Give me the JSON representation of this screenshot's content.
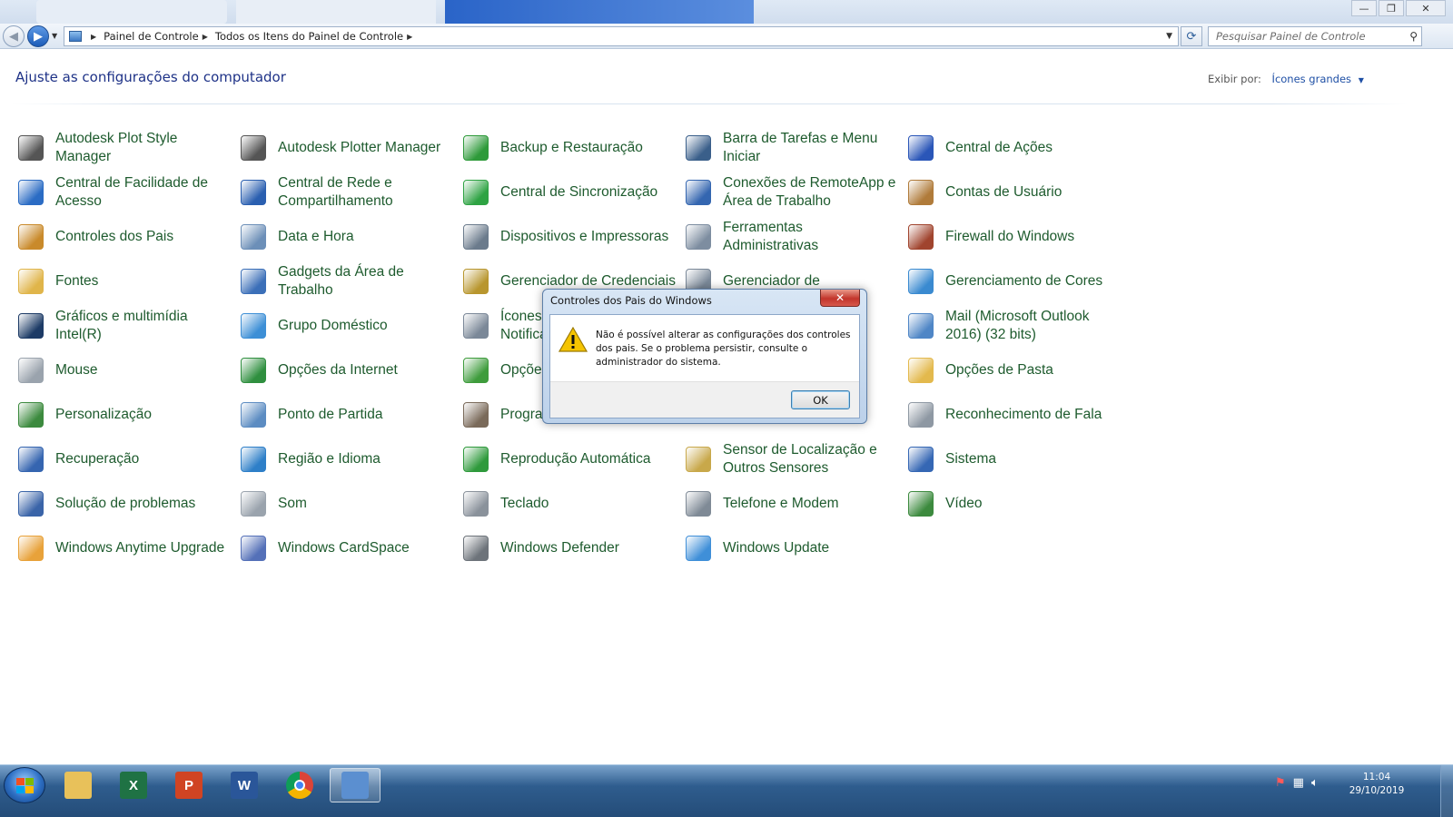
{
  "window": {
    "controls": {
      "minimize": "—",
      "restore": "❐",
      "close": "✕"
    }
  },
  "address": {
    "crumbs": [
      "Painel de Controle",
      "Todos os Itens do Painel de Controle"
    ],
    "search_placeholder": "Pesquisar Painel de Controle"
  },
  "header": {
    "title": "Ajuste as configurações do computador",
    "view_by_label": "Exibir por:",
    "view_by_value": "Ícones grandes"
  },
  "items": [
    {
      "label": "Autodesk Plot Style Manager",
      "icon": "printer-icon",
      "color": "#555555"
    },
    {
      "label": "Autodesk Plotter Manager",
      "icon": "plotter-icon",
      "color": "#555555"
    },
    {
      "label": "Backup e Restauração",
      "icon": "backup-icon",
      "color": "#2e9a3a"
    },
    {
      "label": "Barra de Tarefas e Menu Iniciar",
      "icon": "taskbar-icon",
      "color": "#3a5f8a"
    },
    {
      "label": "Central de Ações",
      "icon": "action-flag-icon",
      "color": "#2a56b8"
    },
    {
      "label": "Central de Facilidade de Acesso",
      "icon": "accessibility-icon",
      "color": "#2b6cc4"
    },
    {
      "label": "Central de Rede e Compartilhamento",
      "icon": "network-icon",
      "color": "#2a5fb0"
    },
    {
      "label": "Central de Sincronização",
      "icon": "sync-icon",
      "color": "#2ea343"
    },
    {
      "label": "Conexões de RemoteApp e Área de Trabalho",
      "icon": "remoteapp-icon",
      "color": "#3466b0"
    },
    {
      "label": "Contas de Usuário",
      "icon": "users-icon",
      "color": "#b07b3a"
    },
    {
      "label": "Controles dos Pais",
      "icon": "parental-icon",
      "color": "#c98a2b"
    },
    {
      "label": "Data e Hora",
      "icon": "calendar-icon",
      "color": "#6c8fb8"
    },
    {
      "label": "Dispositivos e Impressoras",
      "icon": "devices-icon",
      "color": "#6b7b8c"
    },
    {
      "label": "Ferramentas Administrativas",
      "icon": "admin-tools-icon",
      "color": "#7d8da0"
    },
    {
      "label": "Firewall do Windows",
      "icon": "firewall-icon",
      "color": "#a0442e"
    },
    {
      "label": "Fontes",
      "icon": "fonts-icon",
      "color": "#e0b54a"
    },
    {
      "label": "Gadgets da Área de Trabalho",
      "icon": "gadgets-icon",
      "color": "#3b6fb8"
    },
    {
      "label": "Gerenciador de Credenciais",
      "icon": "credentials-icon",
      "color": "#b8962e"
    },
    {
      "label": "Gerenciador de",
      "icon": "device-manager-icon",
      "color": "#7a8898"
    },
    {
      "label": "Gerenciamento de Cores",
      "icon": "color-mgmt-icon",
      "color": "#3a8ad0"
    },
    {
      "label": "Gráficos e multimídia Intel(R)",
      "icon": "intel-graphics-icon",
      "color": "#1d3b66"
    },
    {
      "label": "Grupo Doméstico",
      "icon": "homegroup-icon",
      "color": "#3d8fd6"
    },
    {
      "label": "Ícones da Área de Notificação",
      "icon": "notification-icon",
      "color": "#7b8898"
    },
    {
      "label": "",
      "icon": "hidden-icon",
      "color": "#ffffff"
    },
    {
      "label": "Mail (Microsoft Outlook 2016) (32 bits)",
      "icon": "mail-icon",
      "color": "#4f86c6"
    },
    {
      "label": "Mouse",
      "icon": "mouse-icon",
      "color": "#9aa3ad"
    },
    {
      "label": "Opções da Internet",
      "icon": "internet-options-icon",
      "color": "#2f8f3f"
    },
    {
      "label": "Opções de Energia",
      "icon": "power-icon",
      "color": "#3e9c3c"
    },
    {
      "label": "",
      "icon": "hidden-icon",
      "color": "#ffffff"
    },
    {
      "label": "Opções de Pasta",
      "icon": "folder-options-icon",
      "color": "#e3b94d"
    },
    {
      "label": "Personalização",
      "icon": "personalization-icon",
      "color": "#3c8a3e"
    },
    {
      "label": "Ponto de Partida",
      "icon": "getting-started-icon",
      "color": "#5c8cc2"
    },
    {
      "label": "Programas e Recursos",
      "icon": "programs-icon",
      "color": "#7a6a5a"
    },
    {
      "label": "",
      "icon": "hidden-icon",
      "color": "#ffffff"
    },
    {
      "label": "Reconhecimento de Fala",
      "icon": "microphone-icon",
      "color": "#8e98a3"
    },
    {
      "label": "Recuperação",
      "icon": "recovery-icon",
      "color": "#3565b0"
    },
    {
      "label": "Região e Idioma",
      "icon": "region-icon",
      "color": "#2e7fc8"
    },
    {
      "label": "Reprodução Automática",
      "icon": "autoplay-icon",
      "color": "#2f9a3c"
    },
    {
      "label": "Sensor de Localização e Outros Sensores",
      "icon": "sensor-icon",
      "color": "#c8a84a"
    },
    {
      "label": "Sistema",
      "icon": "system-icon",
      "color": "#3567b4"
    },
    {
      "label": "Solução de problemas",
      "icon": "troubleshoot-icon",
      "color": "#3a64a8"
    },
    {
      "label": "Som",
      "icon": "sound-icon",
      "color": "#9aa3ad"
    },
    {
      "label": "Teclado",
      "icon": "keyboard-icon",
      "color": "#8a929b"
    },
    {
      "label": "Telefone e Modem",
      "icon": "phone-modem-icon",
      "color": "#7f8a96"
    },
    {
      "label": "Vídeo",
      "icon": "display-icon",
      "color": "#3c8a3e"
    },
    {
      "label": "Windows Anytime Upgrade",
      "icon": "windows-upgrade-icon",
      "color": "#e8a23a"
    },
    {
      "label": "Windows CardSpace",
      "icon": "cardspace-icon",
      "color": "#5470b8"
    },
    {
      "label": "Windows Defender",
      "icon": "defender-icon",
      "color": "#6d737a"
    },
    {
      "label": "Windows Update",
      "icon": "windows-update-icon",
      "color": "#3f8fd8"
    }
  ],
  "dialog": {
    "title": "Controles dos Pais do Windows",
    "message": "Não é possível alterar as configurações dos controles dos pais. Se o problema persistir, consulte o administrador do sistema.",
    "ok_label": "OK",
    "close_label": "✕"
  },
  "taskbar": {
    "apps": [
      {
        "name": "explorer",
        "icon": "folder-icon",
        "color": "#e8c15a",
        "glyph": ""
      },
      {
        "name": "excel",
        "icon": "excel-icon",
        "color": "#1f7244",
        "glyph": "X"
      },
      {
        "name": "powerpoint",
        "icon": "powerpoint-icon",
        "color": "#d04423",
        "glyph": "P"
      },
      {
        "name": "word",
        "icon": "word-icon",
        "color": "#2a5699",
        "glyph": "W"
      },
      {
        "name": "chrome",
        "icon": "chrome-icon",
        "color": "#4285f4",
        "glyph": ""
      },
      {
        "name": "control-panel",
        "icon": "control-panel-icon",
        "color": "#5b8fd0",
        "glyph": ""
      }
    ],
    "clock_time": "11:04",
    "clock_date": "29/10/2019"
  },
  "colors": {
    "link_green": "#1e5b2e",
    "heading_blue": "#1e3287",
    "accent_blue": "#1e4fa5"
  }
}
